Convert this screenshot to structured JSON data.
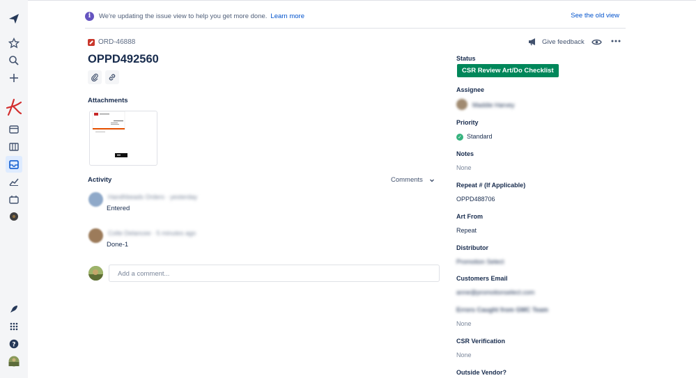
{
  "banner": {
    "message": "We're updating the issue view to help you get more done.",
    "learn_more": "Learn more",
    "old_view": "See the old view"
  },
  "issue": {
    "key": "ORD-46888",
    "title": "OPPD492560"
  },
  "attachments": {
    "label": "Attachments"
  },
  "activity": {
    "label": "Activity",
    "filter": "Comments",
    "items": [
      {
        "author": "Handhbeads Orders",
        "time": "yesterday",
        "text": "Entered"
      },
      {
        "author": "Colte Delancee",
        "time": "5 minutes ago",
        "text": "Done-1"
      }
    ],
    "comment_placeholder": "Add a comment..."
  },
  "header_actions": {
    "feedback": "Give feedback"
  },
  "fields": {
    "status_label": "Status",
    "status_value": "CSR Review Art/Do Checklist",
    "assignee_label": "Assignee",
    "assignee_value": "Maddie Harvey",
    "priority_label": "Priority",
    "priority_value": "Standard",
    "notes_label": "Notes",
    "notes_value": "None",
    "repeat_label": "Repeat # (If Applicable)",
    "repeat_value": "OPPD488706",
    "art_from_label": "Art From",
    "art_from_value": "Repeat",
    "distributor_label": "Distributor",
    "distributor_value": "Promotion Select",
    "customers_email_label": "Customers Email",
    "customers_email_value": "anne@promotionselect.com",
    "errors_label": "Errors Caught from GMC Team",
    "errors_value": "None",
    "csr_label": "CSR Verification",
    "csr_value": "None",
    "outside_vendor_label": "Outside Vendor?"
  },
  "colors": {
    "status": "#00875A",
    "accent": "#0052CC",
    "priority": "#36B37E"
  }
}
